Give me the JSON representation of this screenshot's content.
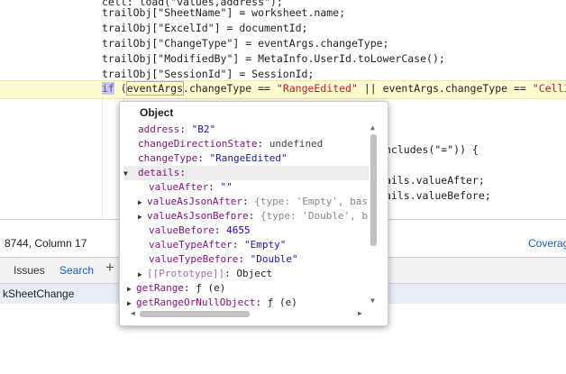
{
  "code": {
    "lines": [
      "trailObj[\"SheetName\"] = worksheet.name;",
      "trailObj[\"ExcelId\"] = documentId;",
      "trailObj[\"ChangeType\"] = eventArgs.changeType;",
      "trailObj[\"ModifiedBy\"] = MetaInfo.UserId.toLowerCase();",
      "trailObj[\"SessionId\"] = SessionId;"
    ],
    "top_partial": "cell: load(\"values,address\");",
    "if_kw": "if",
    "if_open": " (",
    "if_hover": "eventArgs",
    "if_rest1": ".changeType == ",
    "if_str1": "\"RangeEdited\"",
    "if_rest2": " || eventArgs.changeType == ",
    "if_str2": "\"CellInse",
    "right1": "ncludes(\"=\")) {",
    "right2": "ails.valueAfter;",
    "right3": "ails.valueBefore;"
  },
  "status": {
    "position": "8744, Column 17",
    "coverage": "Coverag"
  },
  "drawer": {
    "tabs": [
      "Issues",
      "Search"
    ],
    "active_tab": "Search",
    "row": "kSheetChange"
  },
  "popup": {
    "title": "Object",
    "props": [
      {
        "key": "address",
        "value": "\"B2\""
      },
      {
        "key": "changeDirectionState",
        "value": "undefined"
      },
      {
        "key": "changeType",
        "value": "\"RangeEdited\""
      },
      {
        "key": "details",
        "value": ""
      }
    ],
    "details": [
      {
        "key": "valueAfter",
        "value": "\"\""
      },
      {
        "key": "valueAsJsonAfter",
        "value": "{type: 'Empty', bas"
      },
      {
        "key": "valueAsJsonBefore",
        "value": "{type: 'Double', b"
      },
      {
        "key": "valueBefore",
        "value": "4655"
      },
      {
        "key": "valueTypeAfter",
        "value": "\"Empty\""
      },
      {
        "key": "valueTypeBefore",
        "value": "\"Double\""
      },
      {
        "key": "[[Prototype]]",
        "value": "Object"
      }
    ],
    "methods": [
      {
        "key": "getRange",
        "value": "ƒ (e)"
      },
      {
        "key": "getRangeOrNullObject",
        "value": "ƒ (e)"
      }
    ]
  }
}
